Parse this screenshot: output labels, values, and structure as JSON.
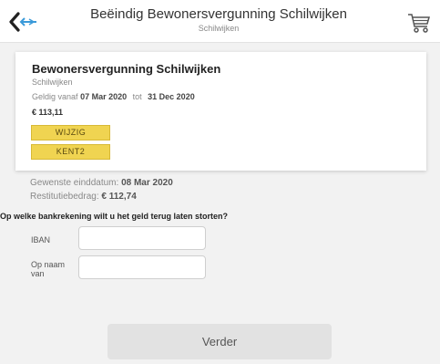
{
  "header": {
    "title": "Beëindig Bewonersvergunning Schilwijken",
    "subtitle": "Schilwijken",
    "back_icon": "back-arrow-icon",
    "cart_icon": "cart-icon"
  },
  "permit": {
    "title": "Bewonersvergunning Schilwijken",
    "area": "Schilwijken",
    "valid_prefix": "Geldig vanaf",
    "valid_from": "07 Mar 2020",
    "valid_sep": "tot",
    "valid_to": "31 Dec 2020",
    "price": "€ 113,11",
    "plates": [
      "WIJZIG",
      "KENT2"
    ]
  },
  "summary": {
    "end_date_label": "Gewenste einddatum:",
    "end_date": "08 Mar 2020",
    "refund_label": "Restitutiebedrag:",
    "refund": "€ 112,74"
  },
  "form": {
    "question": "Op welke bankrekening wilt u het geld terug laten storten?",
    "iban_label": "IBAN",
    "iban_value": "",
    "name_label": "Op naam van",
    "name_value": ""
  },
  "actions": {
    "next_label": "Verder"
  },
  "colors": {
    "plate_yellow": "#f0d451",
    "arrow_blue": "#3a9ad9",
    "button_gray": "#e2e2e2"
  }
}
